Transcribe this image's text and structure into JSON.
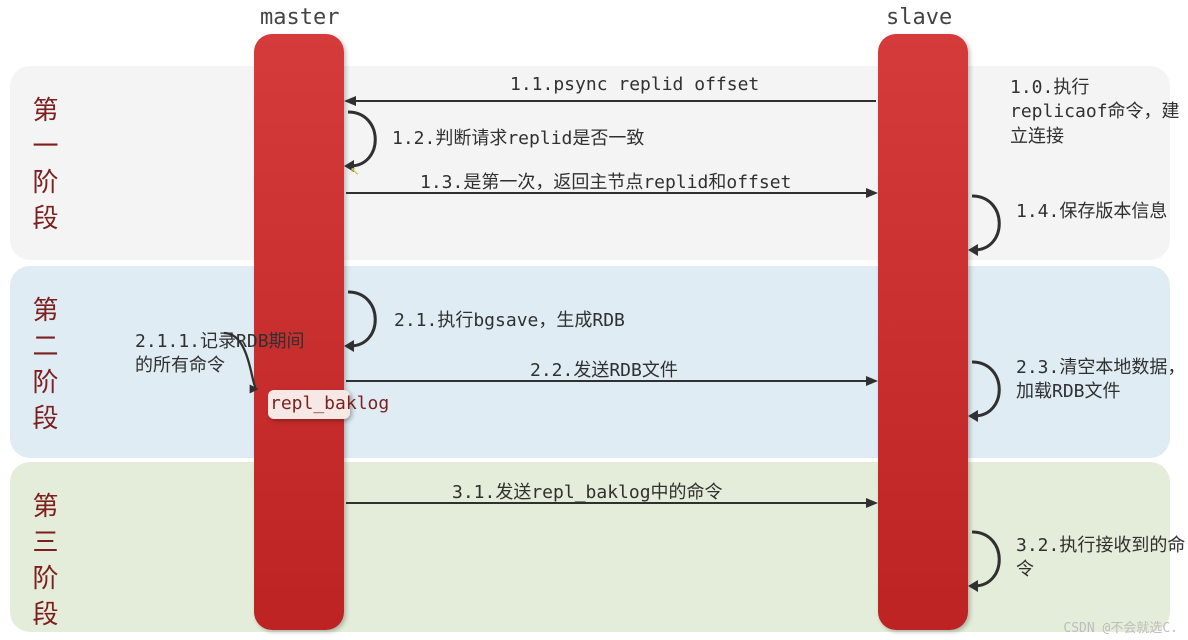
{
  "headers": {
    "master": "master",
    "slave": "slave"
  },
  "stages": {
    "s1": "第一阶段",
    "s2": "第二阶段",
    "s3": "第三阶段"
  },
  "messages": {
    "m11": "1.1.psync replid offset",
    "m12": "1.2.判断请求replid是否一致",
    "m13": "1.3.是第一次，返回主节点replid和offset",
    "m21": "2.1.执行bgsave，生成RDB",
    "m22": "2.2.发送RDB文件",
    "m31": "3.1.发送repl_baklog中的命令"
  },
  "notes": {
    "n10": "1.0.执行replicaof命令，建立连接",
    "n14": "1.4.保存版本信息",
    "n211": "2.1.1.记录RDB期间的所有命令",
    "n23": "2.3.清空本地数据，加载RDB文件",
    "n32": "3.2.执行接收到的命令"
  },
  "repl_box": "repl_baklog",
  "watermark": "CSDN @不会就选C."
}
